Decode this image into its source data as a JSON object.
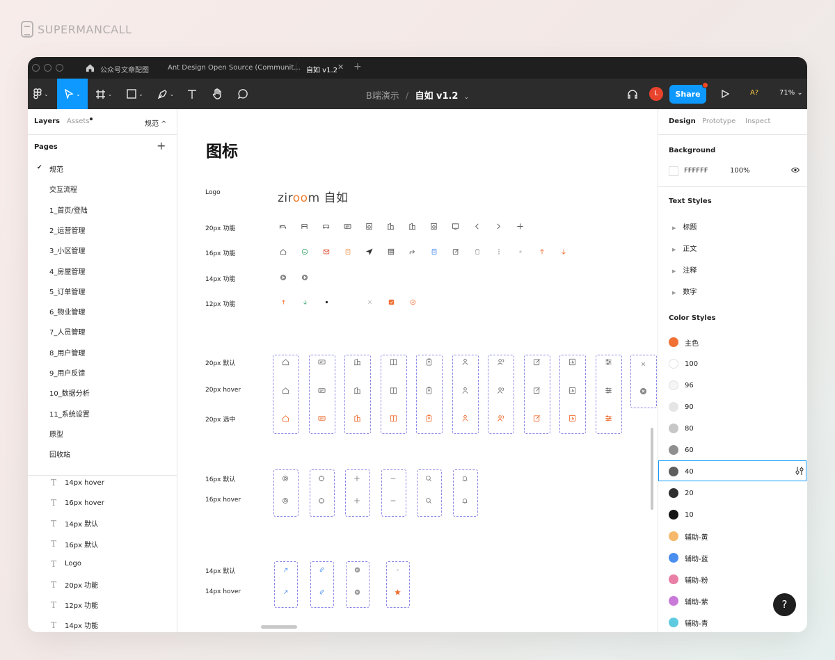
{
  "brand": {
    "name": "SUPERMANCALL"
  },
  "tabs": [
    {
      "label": "公众号文章配图"
    },
    {
      "label": "Ant Design Open Source (Communit..."
    },
    {
      "label": "自如 v1.2"
    }
  ],
  "toolbar": {
    "breadcrumb_parent": "B端演示",
    "breadcrumb_sep": "/",
    "file_title": "自如 v1.2",
    "avatar_letter": "L",
    "share_label": "Share",
    "a11y_label": "A?",
    "zoom": "71%"
  },
  "left_panel": {
    "tab_layers": "Layers",
    "tab_assets": "Assets",
    "current_page": "规范 ^",
    "pages_heading": "Pages",
    "add_page": "+",
    "pages": [
      "规范",
      "交互流程",
      "1_首页/登陆",
      "2_运营管理",
      "3_小区管理",
      "4_房屋管理",
      "5_订单管理",
      "6_物业管理",
      "7_人员管理",
      "8_用户管理",
      "9_用户反馈",
      "10_数据分析",
      "11_系统设置",
      "原型",
      "回收站"
    ],
    "layers": [
      "14px hover",
      "16px hover",
      "14px 默认",
      "16px 默认",
      "Logo",
      "20px 功能",
      "12px 功能",
      "14px 功能"
    ]
  },
  "canvas": {
    "title": "图标",
    "logo_label": "Logo",
    "logo_text_a": "zir",
    "logo_text_oo": "oo",
    "logo_text_b": "m 自如",
    "rows": {
      "f20": "20px 功能",
      "f16": "16px 功能",
      "f14": "14px 功能",
      "f12": "12px 功能",
      "d20": "20px 默认",
      "h20": "20px hover",
      "s20": "20px 选中",
      "d16": "16px 默认",
      "h16": "16px hover",
      "d14": "14px 默认",
      "h14": "14px hover"
    }
  },
  "right_panel": {
    "tab_design": "Design",
    "tab_prototype": "Prototype",
    "tab_inspect": "Inspect",
    "background_heading": "Background",
    "background_hex": "FFFFFF",
    "background_opacity": "100%",
    "text_styles_heading": "Text Styles",
    "text_styles": [
      "标题",
      "正文",
      "注释",
      "数字"
    ],
    "color_styles_heading": "Color Styles",
    "color_styles": [
      {
        "name": "主色",
        "color": "#f07035"
      },
      {
        "name": "100",
        "color": "#ffffff"
      },
      {
        "name": "96",
        "color": "#f5f5f5"
      },
      {
        "name": "90",
        "color": "#e5e5e5"
      },
      {
        "name": "80",
        "color": "#c7c7c7"
      },
      {
        "name": "60",
        "color": "#8f8f8f"
      },
      {
        "name": "40",
        "color": "#5e5e5e"
      },
      {
        "name": "20",
        "color": "#2e2e2e"
      },
      {
        "name": "10",
        "color": "#141414"
      },
      {
        "name": "辅助-黄",
        "color": "#f6b96c"
      },
      {
        "name": "辅助-蓝",
        "color": "#4a8ef0"
      },
      {
        "name": "辅助-粉",
        "color": "#e97ea6"
      },
      {
        "name": "辅助-紫",
        "color": "#c97ad9"
      },
      {
        "name": "辅助-青",
        "color": "#5fcbe0"
      }
    ]
  },
  "help_label": "?"
}
